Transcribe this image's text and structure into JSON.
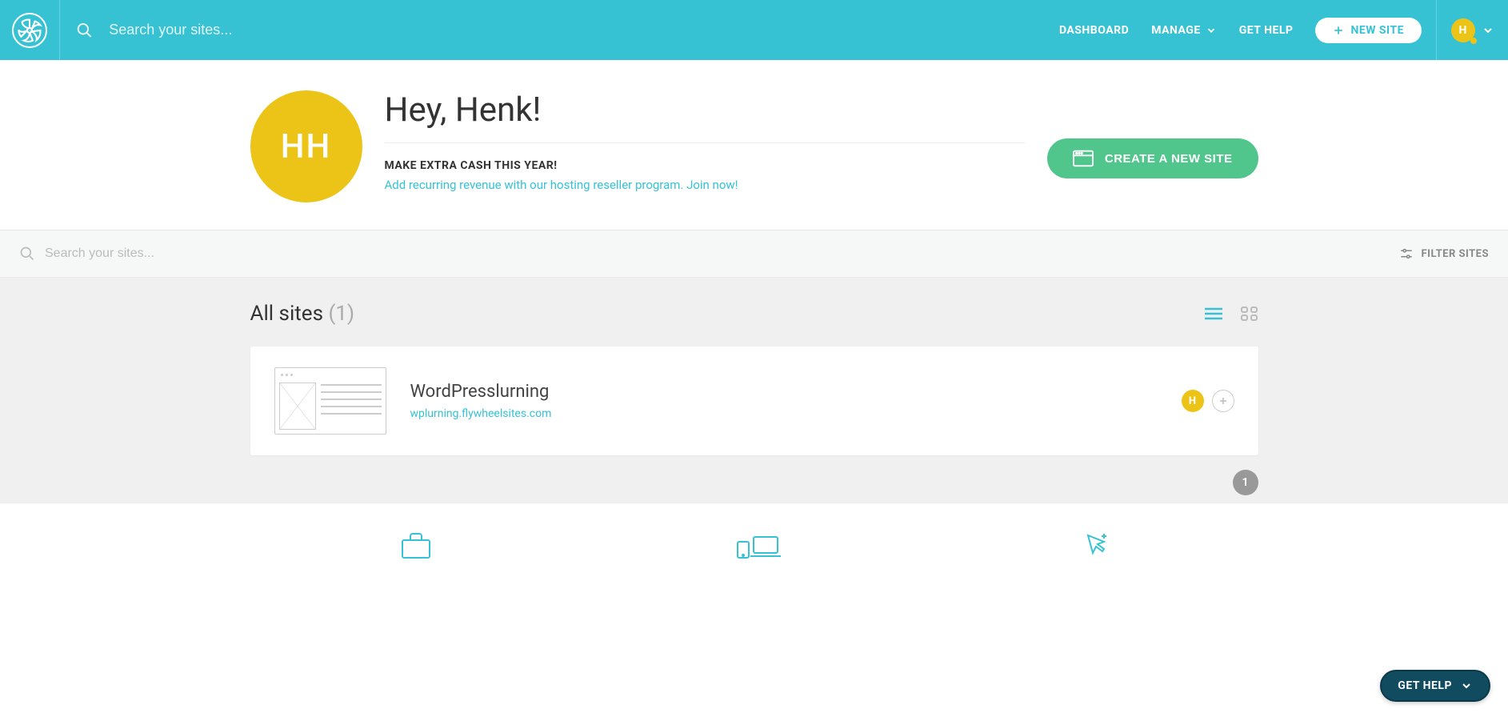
{
  "header": {
    "search_placeholder": "Search your sites...",
    "nav": {
      "dashboard": "DASHBOARD",
      "manage": "MANAGE",
      "get_help": "GET HELP",
      "new_site": "NEW SITE"
    },
    "user_initial": "H"
  },
  "welcome": {
    "greeting": "Hey, Henk!",
    "avatar_initials": "HH",
    "promo_heading": "MAKE EXTRA CASH THIS YEAR!",
    "promo_link": "Add recurring revenue with our hosting reseller program. Join now!",
    "create_button": "CREATE A NEW SITE"
  },
  "filter": {
    "search_placeholder": "Search your sites...",
    "filter_label": "FILTER SITES"
  },
  "sites": {
    "title": "All sites ",
    "count": "(1)",
    "items": [
      {
        "name": "WordPresslurning",
        "url": "wplurning.flywheelsites.com",
        "owner_initial": "H"
      }
    ],
    "page": "1"
  },
  "help_button": "GET HELP"
}
